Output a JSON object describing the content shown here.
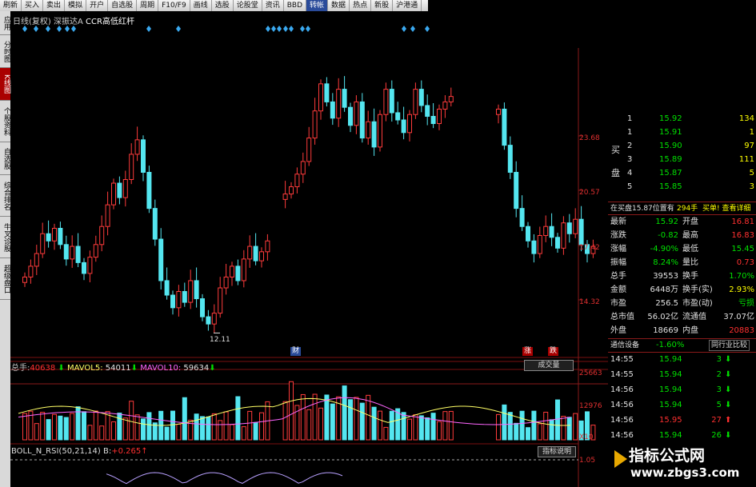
{
  "menubar": [
    "刷新",
    "买入",
    "卖出",
    "模拟",
    "开户",
    "自选股",
    "周期",
    "F10/F9",
    "画线",
    "选股",
    "论股堂",
    "资讯",
    "BBD",
    "转帐",
    "数据",
    "热点",
    "新股",
    "沪港通"
  ],
  "menubar_selected": 13,
  "leftbar": [
    "应用",
    "分时图",
    "K线图",
    "个股资料",
    "自选股",
    "综合排名",
    "牛叉诊股",
    "超级盘口"
  ],
  "leftbar_selected": 2,
  "title": {
    "period": "日线(复权)",
    "stock": "深振达A",
    "indicator": "CCR高低红杆"
  },
  "price_axis": [
    "23.68",
    "20.57",
    "17.42",
    "14.32"
  ],
  "low_label": "12.11",
  "event_tags": [
    {
      "text": "财",
      "color": "#2a4b9a"
    },
    {
      "text": "涨",
      "color": "#a00"
    },
    {
      "text": "跌",
      "color": "#a00"
    }
  ],
  "volume": {
    "hdr_label": "总手:",
    "hdr_value": "40638",
    "ma5_label": "MAVOL5:",
    "ma5_value": "54011",
    "ma10_label": "MAVOL10:",
    "ma10_value": "59634",
    "box": "成交量",
    "axis": [
      "25663",
      "12976",
      "X10"
    ]
  },
  "boll": {
    "label": "BOLL_N_RSI(50,21,14)",
    "b_label": "B:",
    "b_value": "+0.265",
    "button": "指标说明",
    "axis": "1.05"
  },
  "orderbook": {
    "side_label": [
      "买",
      "盘"
    ],
    "rows": [
      {
        "lvl": "1",
        "price": "15.92",
        "vol": "134"
      },
      {
        "lvl": "1",
        "price": "15.91",
        "vol": "1"
      },
      {
        "lvl": "2",
        "price": "15.90",
        "vol": "97"
      },
      {
        "lvl": "3",
        "price": "15.89",
        "vol": "111"
      },
      {
        "lvl": "4",
        "price": "15.87",
        "vol": "5"
      },
      {
        "lvl": "5",
        "price": "15.85",
        "vol": "3"
      }
    ]
  },
  "pending": {
    "left": "在买盘15.87位置有",
    "mid": "294手",
    "right": "买单! 查看详细"
  },
  "quote": [
    {
      "k1": "最新",
      "v1": "15.92",
      "k2": "开盘",
      "v2": "16.81"
    },
    {
      "k1": "涨跌",
      "v1": "-0.82",
      "k2": "最高",
      "v2": "16.83"
    },
    {
      "k1": "涨幅",
      "v1": "-4.90%",
      "k2": "最低",
      "v2": "15.45"
    },
    {
      "k1": "振幅",
      "v1": "8.24%",
      "k2": "量比",
      "v2": "0.73"
    },
    {
      "k1": "总手",
      "v1": "39553",
      "k2": "换手",
      "v2": "1.70%"
    },
    {
      "k1": "金额",
      "v1": "6448万",
      "k2": "换手(实)",
      "v2": "2.93%"
    },
    {
      "k1": "市盈",
      "v1": "256.5",
      "k2": "市盈(动)",
      "v2": "亏损"
    },
    {
      "k1": "总市值",
      "v1": "56.02亿",
      "k2": "流通值",
      "v2": "37.07亿"
    },
    {
      "k1": "外盘",
      "v1": "18669",
      "k2": "内盘",
      "v2": "20883"
    }
  ],
  "industry": {
    "name": "通信设备",
    "change": "-1.60%",
    "button": "同行业比较"
  },
  "ticks": [
    {
      "time": "14:55",
      "price": "15.94",
      "vol": "3",
      "dir": "down"
    },
    {
      "time": "14:55",
      "price": "15.94",
      "vol": "2",
      "dir": "down"
    },
    {
      "time": "14:56",
      "price": "15.94",
      "vol": "3",
      "dir": "down"
    },
    {
      "time": "14:56",
      "price": "15.94",
      "vol": "5",
      "dir": "down"
    },
    {
      "time": "14:56",
      "price": "15.95",
      "vol": "27",
      "dir": "up"
    },
    {
      "time": "14:56",
      "price": "15.94",
      "vol": "26",
      "dir": "down"
    }
  ],
  "watermark": {
    "line1": "指标公式网",
    "line2": "www.zbgs3.com"
  }
}
